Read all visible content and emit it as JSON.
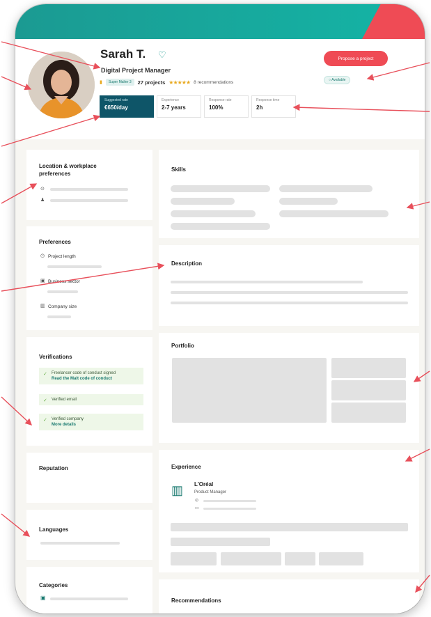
{
  "profile": {
    "name": "Sarah T.",
    "title": "Digital Project Manager",
    "badge": "Super Malter 3",
    "projects": "27 projects",
    "stars": "★★★★★",
    "recommendations": "8 recommendations",
    "availability": "Available",
    "cta": "Propose a project"
  },
  "metrics": [
    {
      "label": "Suggested rate",
      "value": "€650/day"
    },
    {
      "label": "Experience",
      "value": "2-7 years"
    },
    {
      "label": "Response rate",
      "value": "100%"
    },
    {
      "label": "Response time",
      "value": "2h"
    }
  ],
  "left": {
    "location_title": "Location & workplace preferences",
    "preferences_title": "Preferences",
    "pref_project_length": "Project length",
    "pref_business_sector": "Business sector",
    "pref_company_size": "Company size",
    "verifications_title": "Verifications",
    "verif_1_text": "Freelancer code of conduct signed",
    "verif_1_link": "Read the Malt code of conduct",
    "verif_2_text": "Verified email",
    "verif_3_text": "Verified company",
    "verif_3_link": "More details",
    "reputation_title": "Reputation",
    "languages_title": "Languages",
    "categories_title": "Categories"
  },
  "main": {
    "skills_title": "Skills",
    "description_title": "Description",
    "portfolio_title": "Portfolio",
    "experience_title": "Experience",
    "exp_company": "L'Oréal",
    "exp_role": "Product Manager",
    "recommendations_title": "Recommendations"
  },
  "colors": {
    "teal": "#14b5a6",
    "accent_red": "#ef4b55",
    "dark_teal": "#0e5568",
    "arrow": "#e8505b"
  }
}
